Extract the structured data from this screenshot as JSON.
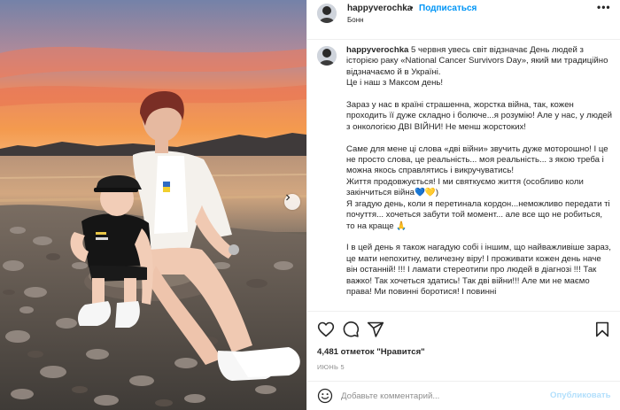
{
  "post": {
    "username": "happyverochka",
    "separator": "•",
    "follow_label": "Подписаться",
    "location": "Бонн",
    "more_label": "•••",
    "caption_text": " 5 червня увесь світ відзначає День людей з історією раку «National Cancer Survivors Day», який ми традиційно відзначаємо й в Україні.\nЦе і наш з Максом день!\n\nЗараз у нас в країні страшенна, жорстка війна, так, кожен проходить її дуже складно і болюче...я розумію! Але у нас, у людей з онкологією ДВІ ВІЙНИ! Не менш жорстоких!\n\nСаме для мене ці слова «дві війни» звучить дуже моторошно! І це не просто слова, це реальність... моя реальність... з якою треба і можна якось справлятись і викручуватись!\nЖиття продовжується! І ми святкуємо життя (особливо коли закінчиться війна💙💛)\nЯ згадую день, коли я перетинала кордон...неможливо передати ті почуття... хочеться забути той момент... але все що не робиться, то на краще 🙏\n\nІ в цей день я також нагадую собі і іншим, що найважливіше зараз, це мати непохитну, величезну віру! І проживати кожен день наче він останній! !!! І ламати стереотипи про людей в діагнозі !!! Так важко! Так хочеться здатись! Так дві війни!!! Але ми не маємо права! Ми повинні боротися! І повинні"
  },
  "actions": {
    "likes_text": "4,481 отметок \"Нравится\"",
    "date_text": "ИЮНЬ 5",
    "icons": [
      "heart-icon",
      "comment-icon",
      "share-icon",
      "bookmark-icon"
    ]
  },
  "comment": {
    "placeholder": "Добавьте комментарий...",
    "publish_label": "Опубликовать"
  },
  "colors": {
    "accent": "#0095f6",
    "publish_disabled": "#b2dffc",
    "text": "#262626",
    "muted": "#8e8e8e"
  }
}
